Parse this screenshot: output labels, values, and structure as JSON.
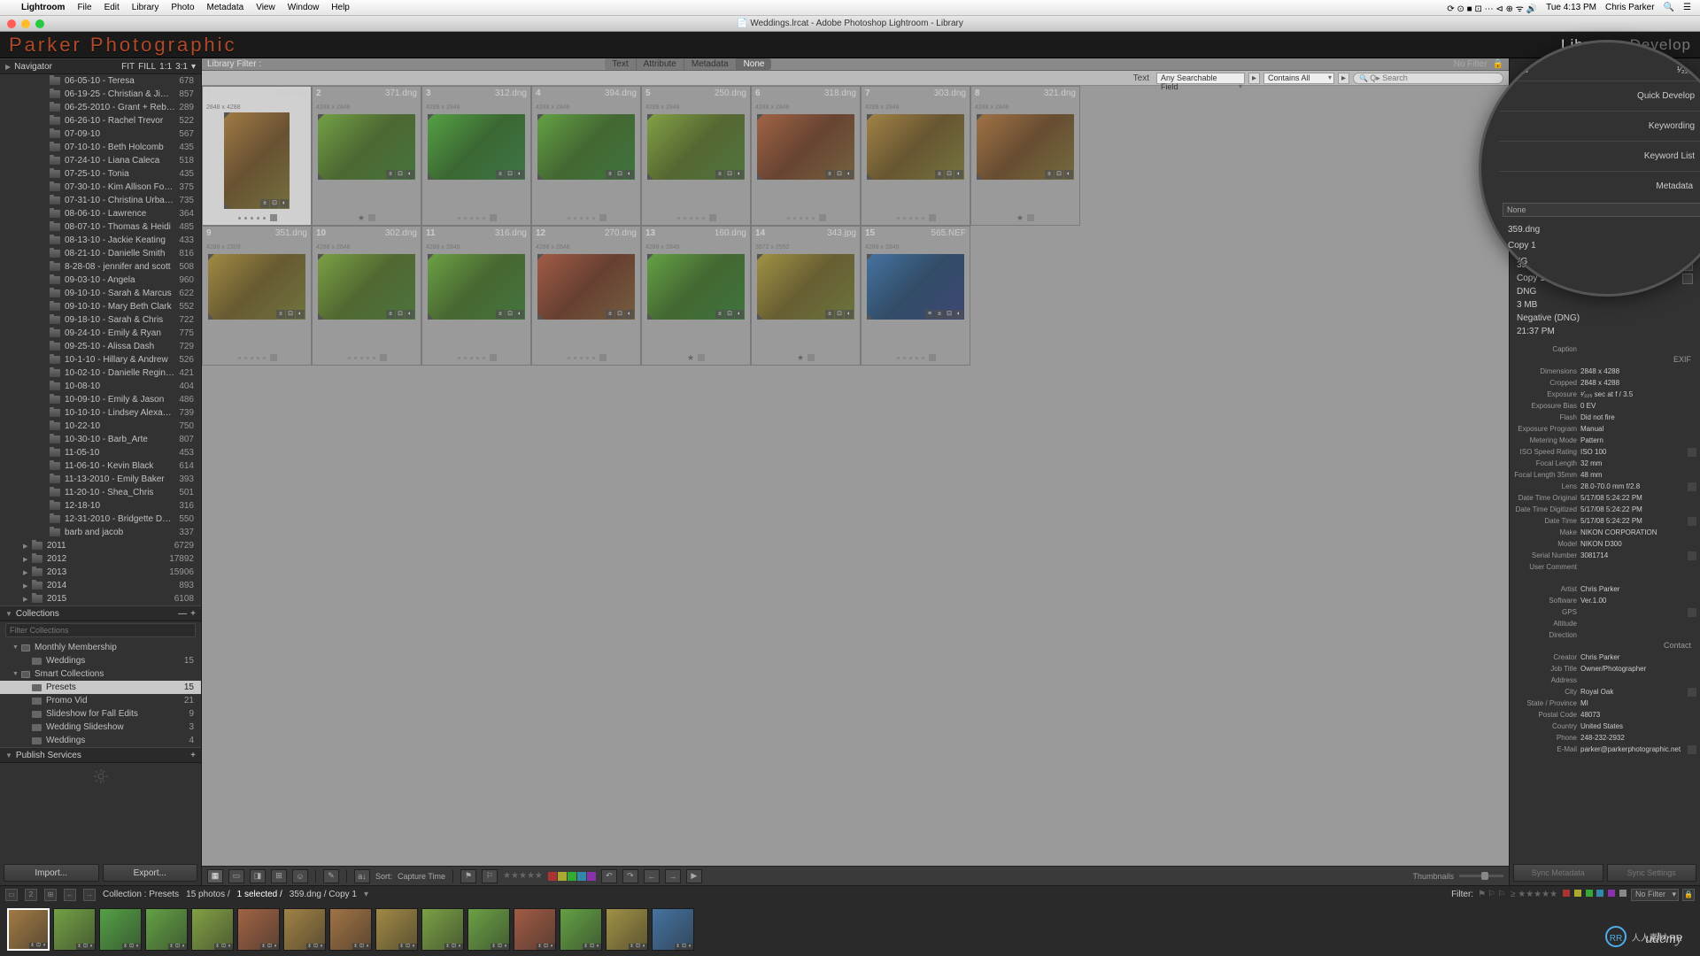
{
  "menubar": {
    "app": "Lightroom",
    "items": [
      "File",
      "Edit",
      "Library",
      "Photo",
      "Metadata",
      "View",
      "Window",
      "Help"
    ],
    "clock": "Tue 4:13 PM",
    "user": "Chris Parker"
  },
  "doc_title": "Weddings.lrcat - Adobe Photoshop Lightroom - Library",
  "brand": "Parker Photographic",
  "modules": {
    "active": "Library",
    "other": "Develop"
  },
  "left": {
    "navigator": "Navigator",
    "nav_opts": [
      "FIT",
      "FILL",
      "1:1",
      "3:1"
    ],
    "folders": [
      {
        "name": "06-05-10 - Teresa",
        "count": 678
      },
      {
        "name": "06-19-25 - Christian & Jimmy",
        "count": 857
      },
      {
        "name": "06-25-2010 - Grant + Rebecca",
        "count": 289
      },
      {
        "name": "06-26-10 - Rachel Trevor",
        "count": 522
      },
      {
        "name": "07-09-10",
        "count": 567
      },
      {
        "name": "07-10-10 - Beth Holcomb",
        "count": 435
      },
      {
        "name": "07-24-10 - Liana Caleca",
        "count": 518
      },
      {
        "name": "07-25-10 - Tonia",
        "count": 435
      },
      {
        "name": "07-30-10 - Kim Allison Forest",
        "count": 375
      },
      {
        "name": "07-31-10 - Christina Urbano…",
        "count": 735
      },
      {
        "name": "08-06-10 - Lawrence",
        "count": 364
      },
      {
        "name": "08-07-10 - Thomas & Heidi",
        "count": 485
      },
      {
        "name": "08-13-10 - Jackie Keating",
        "count": 433
      },
      {
        "name": "08-21-10 - Danielle Smith",
        "count": 816
      },
      {
        "name": "8-28-08 - jennifer and scott",
        "count": 508
      },
      {
        "name": "09-03-10 - Angela",
        "count": 960
      },
      {
        "name": "09-10-10 - Sarah & Marcus",
        "count": 622
      },
      {
        "name": "09-10-10 - Mary Beth Clark",
        "count": 552
      },
      {
        "name": "09-18-10 - Sarah & Chris",
        "count": 722
      },
      {
        "name": "09-24-10 - Emily & Ryan",
        "count": 775
      },
      {
        "name": "09-25-10 - Alissa Dash",
        "count": 729
      },
      {
        "name": "10-1-10 - Hillary & Andrew",
        "count": 526
      },
      {
        "name": "10-02-10 - Danielle Reginella",
        "count": 421
      },
      {
        "name": "10-08-10",
        "count": 404
      },
      {
        "name": "10-09-10 - Emily & Jason",
        "count": 486
      },
      {
        "name": "10-10-10 - Lindsey Alexander",
        "count": 739
      },
      {
        "name": "10-22-10",
        "count": 750
      },
      {
        "name": "10-30-10 - Barb_Arte",
        "count": 807
      },
      {
        "name": "11-05-10",
        "count": 453
      },
      {
        "name": "11-06-10 - Kevin Black",
        "count": 614
      },
      {
        "name": "11-13-2010 - Emily Baker",
        "count": 393
      },
      {
        "name": "11-20-10 - Shea_Chris",
        "count": 501
      },
      {
        "name": "12-18-10",
        "count": 316
      },
      {
        "name": "12-31-2010 - Bridgette Dona…",
        "count": 550
      },
      {
        "name": "barb and jacob",
        "count": 337
      }
    ],
    "years": [
      {
        "name": "2011",
        "count": 6729
      },
      {
        "name": "2012",
        "count": 17892
      },
      {
        "name": "2013",
        "count": 15906
      },
      {
        "name": "2014",
        "count": 893
      },
      {
        "name": "2015",
        "count": 6108
      }
    ],
    "collections_header": "Collections",
    "coll_search_placeholder": "Filter Collections",
    "collections": [
      {
        "label": "Monthly Membership",
        "type": "group"
      },
      {
        "label": "Weddings",
        "count": 15,
        "type": "item",
        "indent": 1
      },
      {
        "label": "Smart Collections",
        "type": "group"
      },
      {
        "label": "Presets",
        "count": 15,
        "type": "item",
        "sel": true
      },
      {
        "label": "Promo Vid",
        "count": 21,
        "type": "item"
      },
      {
        "label": "Slideshow for Fall Edits",
        "count": 9,
        "type": "item"
      },
      {
        "label": "Wedding Slideshow",
        "count": 3,
        "type": "item"
      },
      {
        "label": "Weddings",
        "count": 4,
        "type": "item"
      }
    ],
    "publish": "Publish Services",
    "import": "Import...",
    "export": "Export..."
  },
  "filter": {
    "label": "Library Filter :",
    "tabs": [
      "Text",
      "Attribute",
      "Metadata",
      "None"
    ],
    "active": "None",
    "nofilter": "No Filter",
    "text_label": "Text",
    "dd1": "Any Searchable Field",
    "dd2": "Contains All",
    "search_placeholder": "Q▸ Search"
  },
  "grid": [
    {
      "idx": 1,
      "fn": "359.dng",
      "dim": "2848 x 4288",
      "orient": "p",
      "hue": 35,
      "sel": true,
      "rating": 0
    },
    {
      "idx": 2,
      "fn": "371.dng",
      "dim": "4288 x 2848",
      "orient": "l",
      "hue": 90,
      "rating": 1
    },
    {
      "idx": 3,
      "fn": "312.dng",
      "dim": "4288 x 2848",
      "orient": "l",
      "hue": 110,
      "rating": 0
    },
    {
      "idx": 4,
      "fn": "394.dng",
      "dim": "4288 x 2848",
      "orient": "l",
      "hue": 100,
      "rating": 0
    },
    {
      "idx": 5,
      "fn": "250.dng",
      "dim": "4288 x 2848",
      "orient": "l",
      "hue": 80,
      "rating": 0
    },
    {
      "idx": 6,
      "fn": "318.dng",
      "dim": "4288 x 2848",
      "orient": "l",
      "hue": 20,
      "rating": 0
    },
    {
      "idx": 7,
      "fn": "303.dng",
      "dim": "4288 x 2848",
      "orient": "l",
      "hue": 40,
      "rating": 0
    },
    {
      "idx": 8,
      "fn": "321.dng",
      "dim": "4288 x 2848",
      "orient": "l",
      "hue": 30,
      "rating": 1
    },
    {
      "idx": 9,
      "fn": "351.dng",
      "dim": "4288 x 2309",
      "orient": "l",
      "hue": 45,
      "rating": 0
    },
    {
      "idx": 10,
      "fn": "302.dng",
      "dim": "4288 x 2848",
      "orient": "l",
      "hue": 85,
      "rating": 0
    },
    {
      "idx": 11,
      "fn": "316.dng",
      "dim": "4288 x 2848",
      "orient": "l",
      "hue": 95,
      "rating": 0
    },
    {
      "idx": 12,
      "fn": "270.dng",
      "dim": "4288 x 2848",
      "orient": "l",
      "hue": 15,
      "rating": 0
    },
    {
      "idx": 13,
      "fn": "160.dng",
      "dim": "4288 x 2848",
      "orient": "l",
      "hue": 100,
      "rating": 1
    },
    {
      "idx": 14,
      "fn": "343.jpg",
      "dim": "3872 x 2592",
      "orient": "l",
      "hue": 50,
      "rating": 1
    },
    {
      "idx": 15,
      "fn": "565.NEF",
      "dim": "4288 x 2848",
      "orient": "l",
      "hue": 210,
      "rating": 0,
      "extra_badge": true
    }
  ],
  "toolbar": {
    "sort_label": "Sort:",
    "sort_value": "Capture Time",
    "thumbs": "Thumbnails"
  },
  "infobar": {
    "path": "Collection : Presets",
    "count": "15 photos /",
    "sel": "1 selected /",
    "file": "359.dng / Copy 1",
    "filter": "Filter:",
    "nofilter": "No Filter"
  },
  "right": {
    "aperture": "f / 3.5",
    "shutter": "¹⁄₂₂₅ sec",
    "headers": {
      "quick": "Quick Develop",
      "keywording": "Keywording",
      "keywordlist": "Keyword List",
      "metadata": "Metadata"
    },
    "preset": "None",
    "big": [
      {
        "v": "359.dng",
        "b": true
      },
      {
        "v": "Copy 1",
        "b": true
      },
      {
        "v": "DNG"
      },
      {
        "v": "3 MB"
      },
      {
        "v": "Negative (DNG)"
      },
      {
        "v": "21:37 PM"
      }
    ],
    "caption_label": "Caption",
    "exif_header": "EXIF",
    "exif": [
      {
        "l": "Dimensions",
        "v": "2848 x 4288"
      },
      {
        "l": "Cropped",
        "v": "2848 x 4288"
      },
      {
        "l": "Exposure",
        "v": "¹⁄₂₂₅ sec at f / 3.5"
      },
      {
        "l": "Exposure Bias",
        "v": "0 EV"
      },
      {
        "l": "Flash",
        "v": "Did not fire"
      },
      {
        "l": "Exposure Program",
        "v": "Manual"
      },
      {
        "l": "Metering Mode",
        "v": "Pattern"
      },
      {
        "l": "ISO Speed Rating",
        "v": "ISO 100",
        "go": true
      },
      {
        "l": "Focal Length",
        "v": "32 mm"
      },
      {
        "l": "Focal Length 35mm",
        "v": "48 mm"
      },
      {
        "l": "Lens",
        "v": "28.0-70.0 mm f/2.8",
        "go": true
      },
      {
        "l": "Date Time Original",
        "v": "5/17/08 5:24:22 PM"
      },
      {
        "l": "Date Time Digitized",
        "v": "5/17/08 5:24:22 PM"
      },
      {
        "l": "Date Time",
        "v": "5/17/08 5:24:22 PM",
        "go": true
      },
      {
        "l": "Make",
        "v": "NIKON CORPORATION"
      },
      {
        "l": "Model",
        "v": "NIKON D300"
      },
      {
        "l": "Serial Number",
        "v": "3081714",
        "go": true
      },
      {
        "l": "User Comment",
        "v": ""
      }
    ],
    "artist": [
      {
        "l": "Artist",
        "v": "Chris Parker"
      },
      {
        "l": "Software",
        "v": "Ver.1.00"
      },
      {
        "l": "GPS",
        "v": "",
        "go": true
      },
      {
        "l": "Altitude",
        "v": ""
      },
      {
        "l": "Direction",
        "v": ""
      }
    ],
    "contact_header": "Contact",
    "contact": [
      {
        "l": "Creator",
        "v": "Chris Parker"
      },
      {
        "l": "Job Title",
        "v": "Owner/Photographer"
      },
      {
        "l": "Address",
        "v": ""
      },
      {
        "l": "City",
        "v": "Royal Oak",
        "go": true
      },
      {
        "l": "State / Province",
        "v": "MI"
      },
      {
        "l": "Postal Code",
        "v": "48073"
      },
      {
        "l": "Country",
        "v": "United States"
      },
      {
        "l": "Phone",
        "v": "248-232-2932"
      },
      {
        "l": "E-Mail",
        "v": "parker@parkerphotographic.net",
        "go": true
      }
    ],
    "sync_meta": "Sync Metadata",
    "sync_set": "Sync Settings"
  },
  "watermark": "人人素材 RR",
  "udemy": "udemy"
}
